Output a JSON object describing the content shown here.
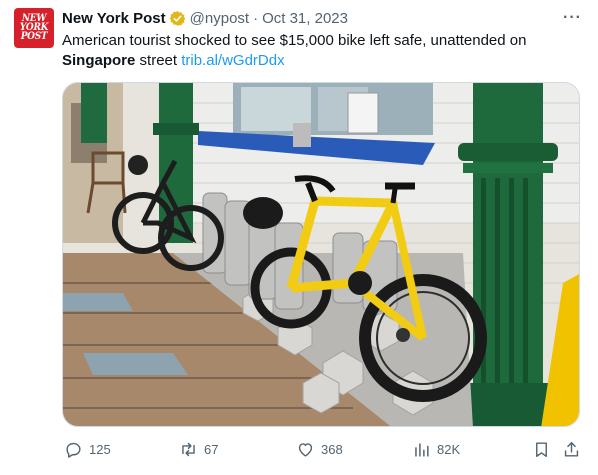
{
  "tweet": {
    "avatar_lines": [
      "NEW",
      "YORK",
      "POST"
    ],
    "display_name": "New York Post",
    "handle": "@nypost",
    "separator": "·",
    "date": "Oct 31, 2023",
    "more_label": "···",
    "text_plain": "American tourist shocked to see $15,000 bike left safe, unattended on",
    "text_bold": "Singapore",
    "text_after": " street ",
    "link": "trib.al/wGdrDdx"
  },
  "actions": {
    "replies": "125",
    "reposts": "67",
    "likes": "368",
    "views": "82K"
  },
  "colors": {
    "brand": "#d6202a",
    "verified_gold": "#e2b719",
    "link": "#1d9bf0",
    "muted": "#536471"
  },
  "icons": [
    "verified-badge-icon",
    "more-icon",
    "reply-icon",
    "repost-icon",
    "like-icon",
    "views-icon",
    "bookmark-icon",
    "share-icon"
  ]
}
